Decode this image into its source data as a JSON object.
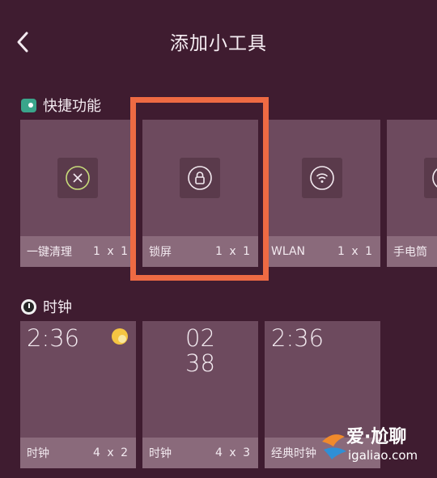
{
  "header": {
    "title": "添加小工具"
  },
  "sections": {
    "quick": {
      "label": "快捷功能"
    },
    "clock": {
      "label": "时钟"
    }
  },
  "quick_tiles": [
    {
      "name": "一键清理",
      "size": "1 x 1",
      "icon": "clean-x-icon"
    },
    {
      "name": "锁屏",
      "size": "1 x 1",
      "icon": "lock-icon"
    },
    {
      "name": "WLAN",
      "size": "1 x 1",
      "icon": "wifi-icon"
    },
    {
      "name": "手电筒",
      "size": "",
      "icon": "flashlight-icon"
    }
  ],
  "clock_tiles": [
    {
      "name": "时钟",
      "size": "4 x 2",
      "time": "2:36",
      "icon": "weather-sun-icon"
    },
    {
      "name": "时钟",
      "size": "4 x 3",
      "hour": "02",
      "minute": "38"
    },
    {
      "name": "经典时钟",
      "size": "",
      "time": "2:36"
    }
  ],
  "watermark": {
    "text": "爱·尬聊",
    "url": "igaliao.com"
  },
  "colors": {
    "background": "#3f1c30",
    "tile": "#6d4a5e",
    "tile_footer": "#8a6a7b",
    "highlight": "#ee6a43",
    "toggle_icon": "#3aa58b"
  }
}
